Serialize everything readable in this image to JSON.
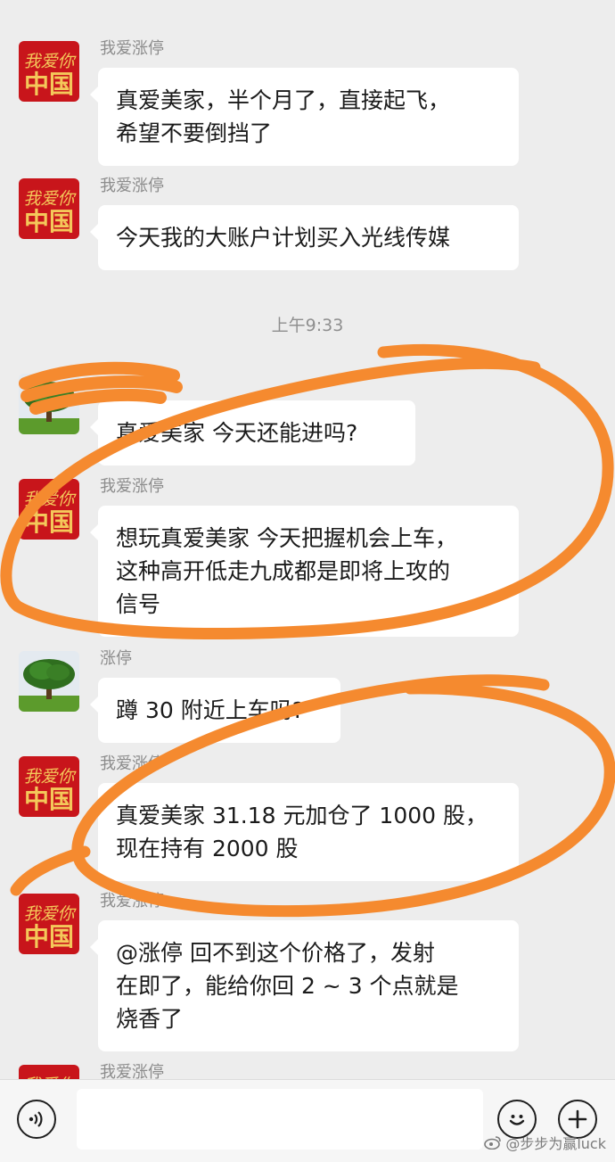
{
  "chat": {
    "timestamp": "上午9:33",
    "messages": [
      {
        "sender": "我爱涨停",
        "lines": [
          "真爱美家，半个月了，直接起飞，",
          "希望不要倒挡了"
        ]
      },
      {
        "sender": "我爱涨停",
        "lines": [
          "今天我的大账户计划买入光线传媒"
        ]
      },
      {
        "sender": "",
        "lines": [
          "真爱美家 今天还能进吗?"
        ]
      },
      {
        "sender": "我爱涨停",
        "lines": [
          "想玩真爱美家 今天把握机会上车，",
          "这种高开低走九成都是即将上攻的",
          "信号"
        ]
      },
      {
        "sender": "涨停",
        "lines": [
          "蹲 30 附近上车吗?"
        ]
      },
      {
        "sender": "我爱涨停",
        "lines": [
          "真爱美家  31.18 元加仓了 1000 股，",
          "现在持有 2000 股"
        ]
      },
      {
        "sender": "我爱涨停",
        "lines": [
          "@涨停  回不到这个价格了，发射",
          "在即了，能给你回 2 ~ 3 个点就是",
          "烧香了"
        ]
      },
      {
        "sender": "我爱涨停",
        "lines": []
      }
    ]
  },
  "avatar_text": {
    "line1": "我爱你",
    "line2": "中国"
  },
  "input_bar": {
    "voice_icon": "voice-icon",
    "emoji_icon": "emoji-icon",
    "add_icon": "plus-icon"
  },
  "watermark": "@步步为赢luck",
  "colors": {
    "background": "#ededed",
    "bubble": "#ffffff",
    "annotation": "#f58a2f",
    "avatar_red": "#c8151b",
    "avatar_gold": "#f4c85a"
  }
}
